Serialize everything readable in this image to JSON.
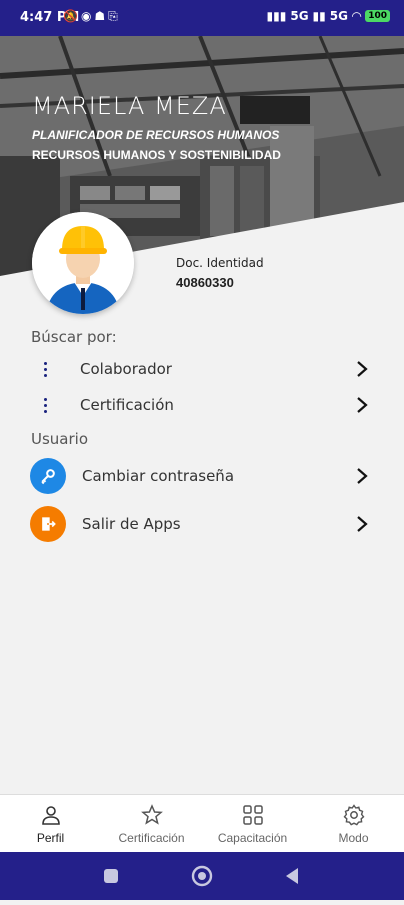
{
  "status_bar": {
    "time": "4:47 PM",
    "network_1": "5G",
    "network_2": "5G",
    "battery": "100"
  },
  "profile": {
    "name": "MARIELA MEZA",
    "role": "PLANIFICADOR DE RECURSOS HUMANOS",
    "area": "RECURSOS HUMANOS Y SOSTENIBILIDAD",
    "doc_label": "Doc. Identidad",
    "doc_number": "40860330"
  },
  "search": {
    "title": "Búscar por:",
    "items": [
      {
        "label": "Colaborador"
      },
      {
        "label": "Certificación"
      }
    ]
  },
  "user": {
    "title": "Usuario",
    "items": [
      {
        "label": "Cambiar contraseña",
        "icon": "key-icon",
        "color": "#1e88e5"
      },
      {
        "label": "Salir de Apps",
        "icon": "exit-icon",
        "color": "#f57c00"
      }
    ]
  },
  "bottom_nav": [
    {
      "label": "Perfil",
      "icon": "person-icon",
      "active": true
    },
    {
      "label": "Certificación",
      "icon": "star-icon"
    },
    {
      "label": "Capacitación",
      "icon": "grid-icon"
    },
    {
      "label": "Modo",
      "icon": "gear-icon"
    }
  ],
  "colors": {
    "status_bar": "#24208a",
    "accent": "#1a237e"
  }
}
